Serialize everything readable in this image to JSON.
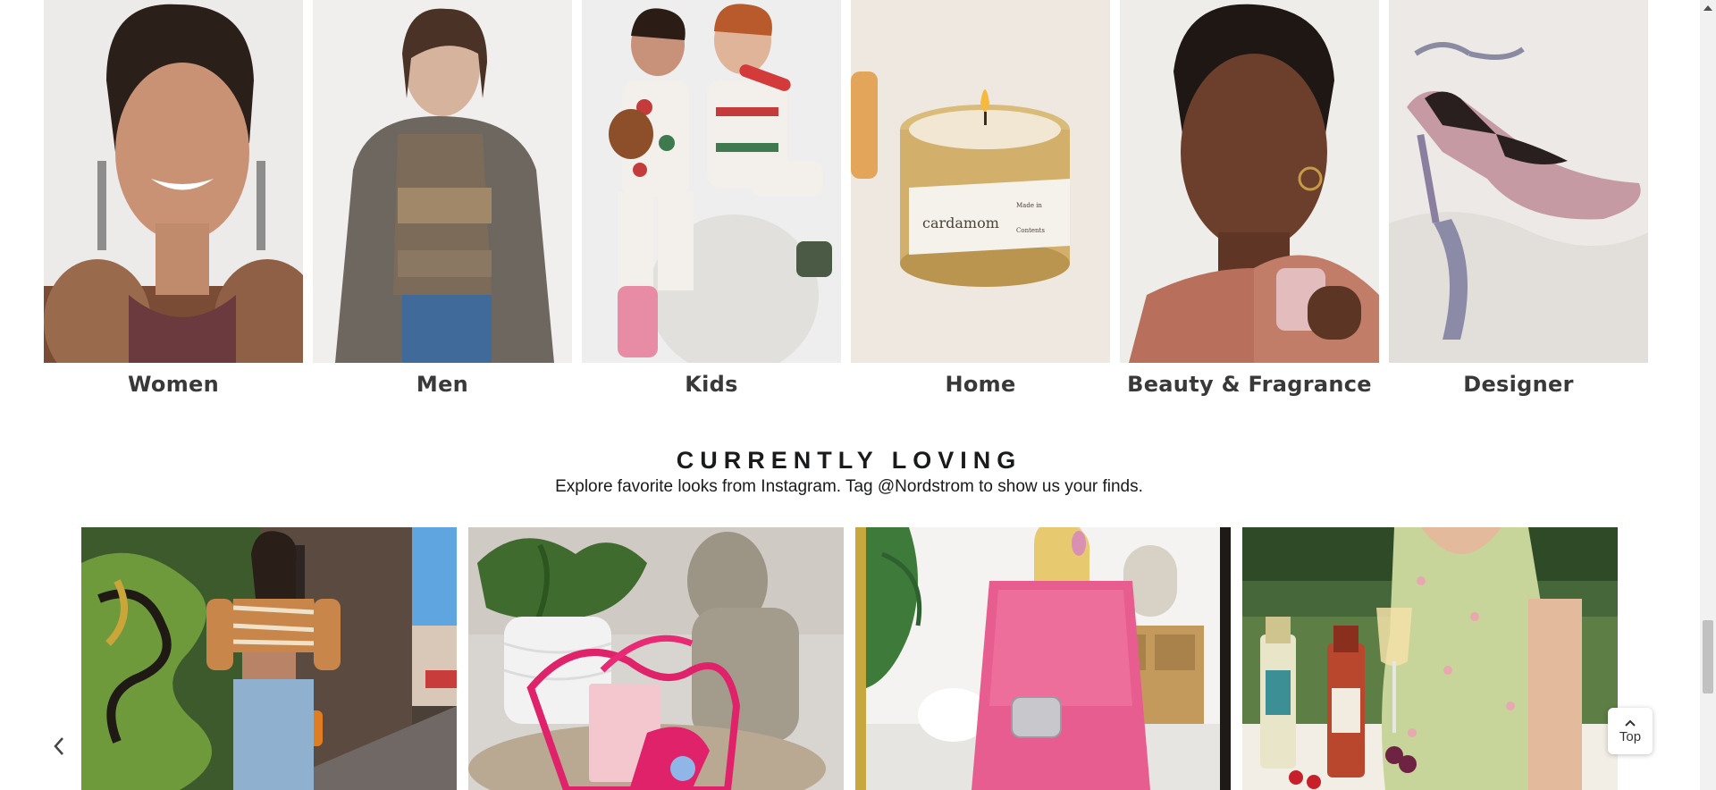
{
  "categories": [
    {
      "label": "Women",
      "icon": "women-category-image"
    },
    {
      "label": "Men",
      "icon": "men-category-image"
    },
    {
      "label": "Kids",
      "icon": "kids-category-image"
    },
    {
      "label": "Home",
      "icon": "home-category-image"
    },
    {
      "label": "Beauty & Fragrance",
      "icon": "beauty-category-image"
    },
    {
      "label": "Designer",
      "icon": "designer-category-image"
    }
  ],
  "loving": {
    "title": "CURRENTLY LOVING",
    "subtitle": "Explore favorite looks from Instagram. Tag @Nordstrom to show us your finds."
  },
  "candle_text": {
    "name": "cardamom",
    "made_in": "Made in",
    "contents": "Contents"
  },
  "top_button": {
    "label": "Top"
  },
  "colors": {
    "text": "#191a1b",
    "label": "#393939",
    "scrollbar_track": "#f1f1f1",
    "scrollbar_thumb": "#c1c1c1"
  }
}
